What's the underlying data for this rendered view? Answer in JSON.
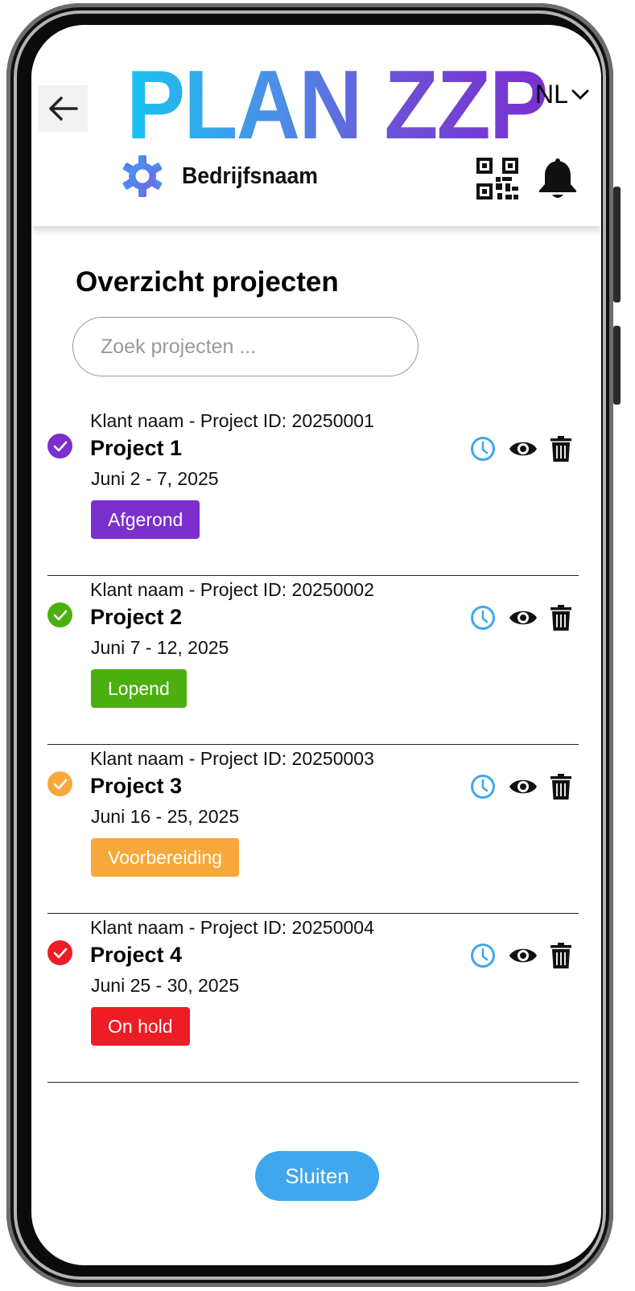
{
  "header": {
    "brand": "PLAN ZZP",
    "language": "NL",
    "company": "Bedrijfsnaam",
    "icons": {
      "back": "arrow-left-icon",
      "lang": "chevron-down-icon",
      "settings": "gear-icon",
      "qr": "qr-code-icon",
      "notifications": "bell-icon"
    }
  },
  "page": {
    "title": "Overzicht projecten",
    "search_placeholder": "Zoek projecten ..."
  },
  "projects": [
    {
      "client": "Klant naam - Project ID: 20250001",
      "name": "Project 1",
      "dates": "Juni 2 - 7, 2025",
      "status": "Afgerond",
      "color": "#7b2fcc"
    },
    {
      "client": "Klant naam - Project ID: 20250002",
      "name": "Project 2",
      "dates": "Juni 7 - 12, 2025",
      "status": "Lopend",
      "color": "#4caf10"
    },
    {
      "client": "Klant naam - Project ID: 20250003",
      "name": "Project 3",
      "dates": "Juni 16 - 25, 2025",
      "status": "Voorbereiding",
      "color": "#f7a83a"
    },
    {
      "client": "Klant naam - Project ID: 20250004",
      "name": "Project 4",
      "dates": "Juni 25 - 30, 2025",
      "status": "On hold",
      "color": "#ee1c25"
    }
  ],
  "actions": {
    "icons": [
      "clock-icon",
      "eye-icon",
      "trash-icon"
    ],
    "clock_color": "#3fa7ee"
  },
  "footer": {
    "close_label": "Sluiten",
    "close_color": "#3fa7ee"
  }
}
